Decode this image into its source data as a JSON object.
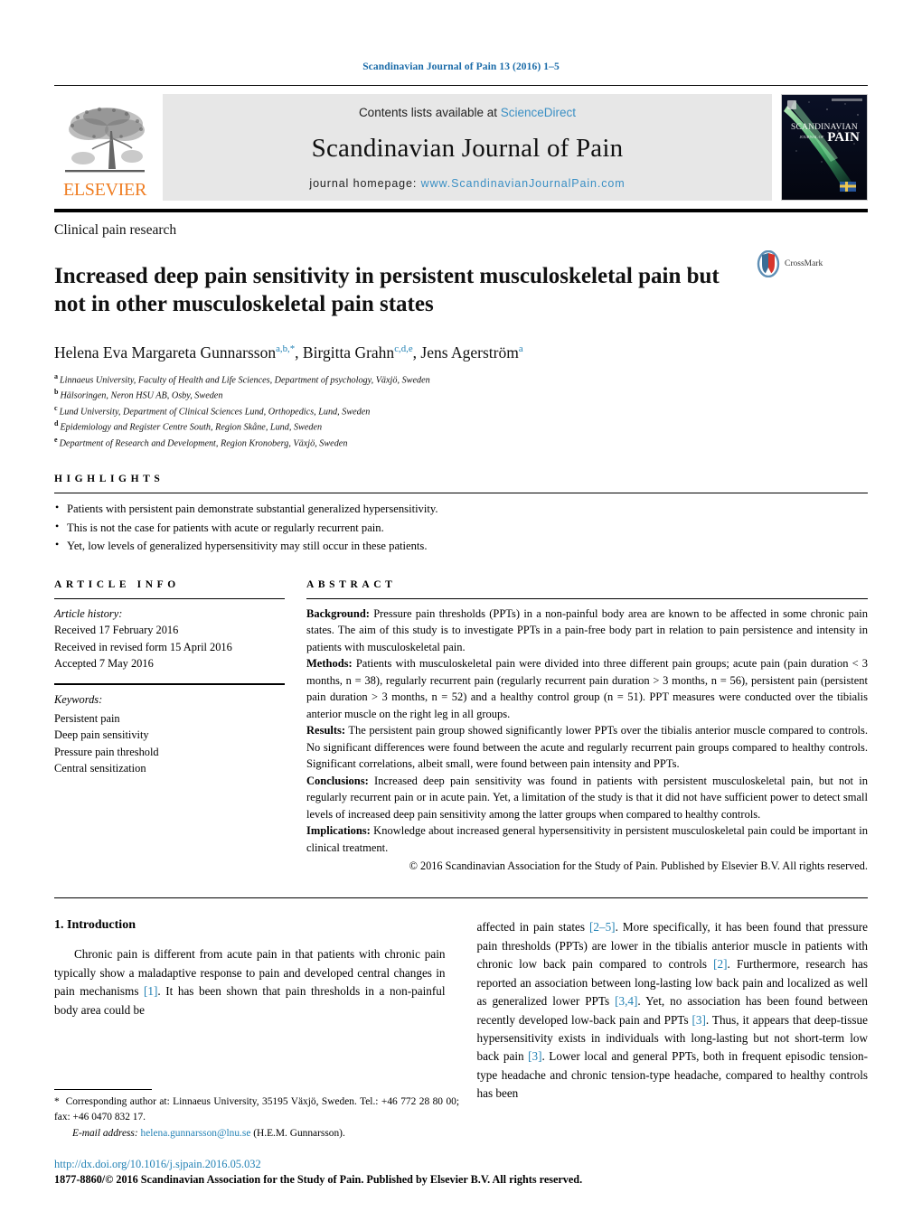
{
  "running_head": "Scandinavian Journal of Pain 13 (2016) 1–5",
  "masthead": {
    "contents_prefix": "Contents lists available at ",
    "sciencedirect": "ScienceDirect",
    "journal_name": "Scandinavian Journal of Pain",
    "homepage_prefix": "journal homepage: ",
    "homepage_url": "www.ScandinavianJournalPain.com",
    "publisher": "ELSEVIER",
    "cover_title_line1": "SCANDINAVIAN",
    "cover_title_line2": "JOURNAL OF",
    "cover_title_line3": "PAIN"
  },
  "article": {
    "kind": "Clinical pain research",
    "title": "Increased deep pain sensitivity in persistent musculoskeletal pain but not in other musculoskeletal pain states",
    "crossmark_label": "CrossMark",
    "authors": [
      {
        "name": "Helena Eva Margareta Gunnarsson",
        "marks": "a,b,",
        "star": "*"
      },
      {
        "name": "Birgitta Grahn",
        "marks": "c,d,e",
        "star": ""
      },
      {
        "name": "Jens Agerström",
        "marks": "a",
        "star": ""
      }
    ],
    "affiliations": [
      {
        "label": "a",
        "text": "Linnaeus University, Faculty of Health and Life Sciences, Department of psychology, Växjö, Sweden"
      },
      {
        "label": "b",
        "text": "Hälsoringen, Neron HSU AB, Osby, Sweden"
      },
      {
        "label": "c",
        "text": "Lund University, Department of Clinical Sciences Lund, Orthopedics, Lund, Sweden"
      },
      {
        "label": "d",
        "text": "Epidemiology and Register Centre South, Region Skåne, Lund, Sweden"
      },
      {
        "label": "e",
        "text": "Department of Research and Development, Region Kronoberg, Växjö, Sweden"
      }
    ]
  },
  "highlights": {
    "heading": "HIGHLIGHTS",
    "items": [
      "Patients with persistent pain demonstrate substantial generalized hypersensitivity.",
      "This is not the case for patients with acute or regularly recurrent pain.",
      "Yet, low levels of generalized hypersensitivity may still occur in these patients."
    ]
  },
  "article_info": {
    "heading": "ARTICLE INFO",
    "history_label": "Article history:",
    "history": [
      "Received 17 February 2016",
      "Received in revised form 15 April 2016",
      "Accepted 7 May 2016"
    ],
    "keywords_label": "Keywords:",
    "keywords": [
      "Persistent pain",
      "Deep pain sensitivity",
      "Pressure pain threshold",
      "Central sensitization"
    ]
  },
  "abstract": {
    "heading": "ABSTRACT",
    "sections": [
      {
        "label": "Background:",
        "text": " Pressure pain thresholds (PPTs) in a non-painful body area are known to be affected in some chronic pain states. The aim of this study is to investigate PPTs in a pain-free body part in relation to pain persistence and intensity in patients with musculoskeletal pain."
      },
      {
        "label": "Methods:",
        "text": " Patients with musculoskeletal pain were divided into three different pain groups; acute pain (pain duration < 3 months, n = 38), regularly recurrent pain (regularly recurrent pain duration > 3 months, n = 56), persistent pain (persistent pain duration > 3 months, n = 52) and a healthy control group (n = 51). PPT measures were conducted over the tibialis anterior muscle on the right leg in all groups."
      },
      {
        "label": "Results:",
        "text": " The persistent pain group showed significantly lower PPTs over the tibialis anterior muscle compared to controls. No significant differences were found between the acute and regularly recurrent pain groups compared to healthy controls. Significant correlations, albeit small, were found between pain intensity and PPTs."
      },
      {
        "label": "Conclusions:",
        "text": " Increased deep pain sensitivity was found in patients with persistent musculoskeletal pain, but not in regularly recurrent pain or in acute pain. Yet, a limitation of the study is that it did not have sufficient power to detect small levels of increased deep pain sensitivity among the latter groups when compared to healthy controls."
      },
      {
        "label": "Implications:",
        "text": " Knowledge about increased general hypersensitivity in persistent musculoskeletal pain could be important in clinical treatment."
      }
    ],
    "copyright": "© 2016 Scandinavian Association for the Study of Pain. Published by Elsevier B.V. All rights reserved."
  },
  "body": {
    "section_number_title": "1.  Introduction",
    "left_paragraph_parts": [
      "Chronic pain is different from acute pain in that patients with chronic pain typically show a maladaptive response to pain and developed central changes in pain mechanisms ",
      "[1]",
      ". It has been shown that pain thresholds in a non-painful body area could be"
    ],
    "right_paragraph_parts": [
      "affected in pain states ",
      "[2–5]",
      ". More specifically, it has been found that pressure pain thresholds (PPTs) are lower in the tibialis anterior muscle in patients with chronic low back pain compared to controls ",
      "[2]",
      ". Furthermore, research has reported an association between long-lasting low back pain and localized as well as generalized lower PPTs ",
      "[3,4]",
      ". Yet, no association has been found between recently developed low-back pain and PPTs ",
      "[3]",
      ". Thus, it appears that deep-tissue hypersensitivity exists in individuals with long-lasting but not short-term low back pain ",
      "[3]",
      ". Lower local and general PPTs, both in frequent episodic tension-type headache and chronic tension-type headache, compared to healthy controls has been"
    ]
  },
  "footnote": {
    "star": "*",
    "corresponding": "Corresponding author at: Linnaeus University, 35195 Växjö, Sweden. Tel.: +46 772 28 80 00; fax: +46 0470 832 17.",
    "email_label": "E-mail address:",
    "email": "helena.gunnarsson@lnu.se",
    "email_suffix": "(H.E.M. Gunnarsson)."
  },
  "footer": {
    "doi": "http://dx.doi.org/10.1016/j.sjpain.2016.05.032",
    "issn_line": "1877-8860/© 2016 Scandinavian Association for the Study of Pain. Published by Elsevier B.V. All rights reserved."
  },
  "colors": {
    "link": "#2382b5",
    "elsevier_orange": "#ef7d22",
    "masthead_grey": "#e7e7e7"
  }
}
